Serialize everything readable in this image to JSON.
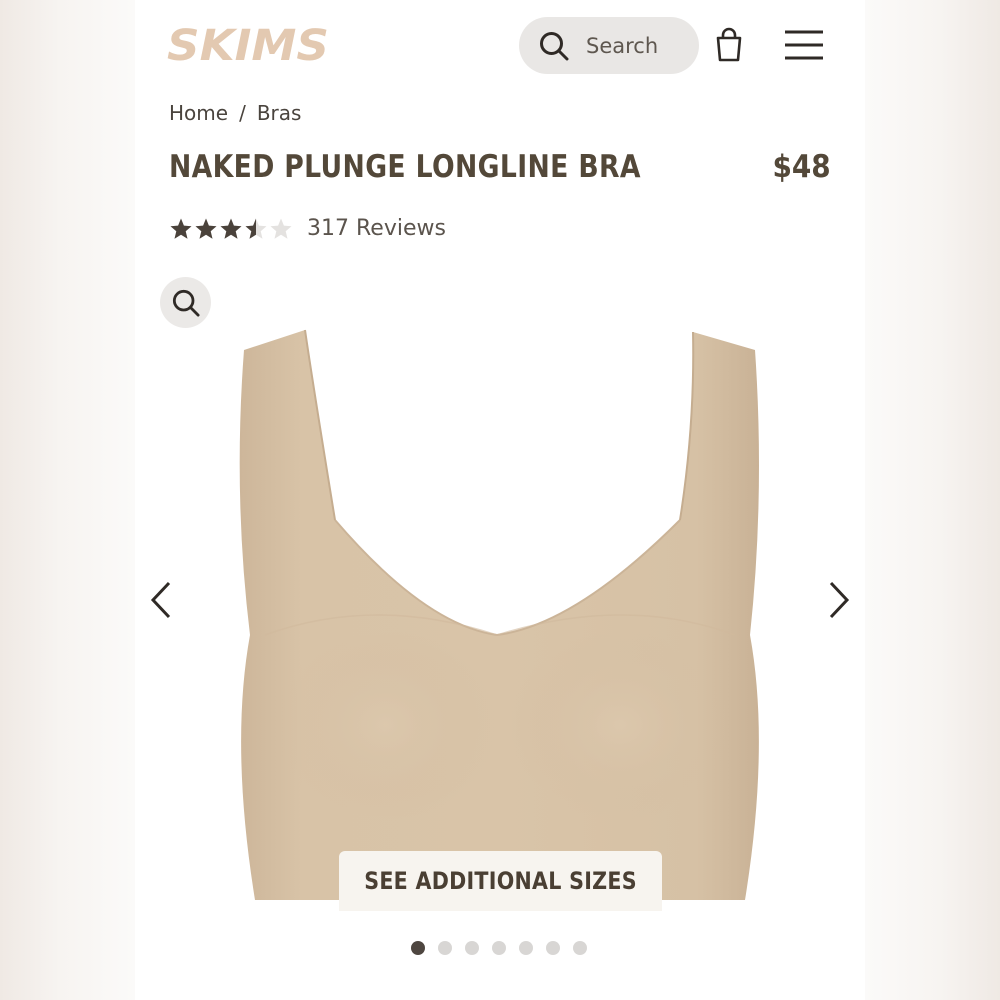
{
  "header": {
    "logo_text": "SKIMS",
    "search_label": "Search",
    "icons": [
      "search-icon",
      "bag-icon",
      "menu-icon"
    ]
  },
  "breadcrumb": {
    "items": [
      "Home",
      "Bras"
    ],
    "separator": "/"
  },
  "product": {
    "title": "NAKED PLUNGE LONGLINE BRA",
    "price": "$48",
    "rating": 3.5,
    "rating_max": 5,
    "reviews_label": "317 Reviews",
    "image_color": "#d9c4a8"
  },
  "gallery": {
    "see_sizes_label": "SEE ADDITIONAL SIZES",
    "slide_count": 7,
    "active_slide": 1
  },
  "colors": {
    "logo": "#e3c9b1",
    "text": "#534839",
    "active_dot": "#4e4640",
    "inactive_dot": "#d8d6d4"
  }
}
